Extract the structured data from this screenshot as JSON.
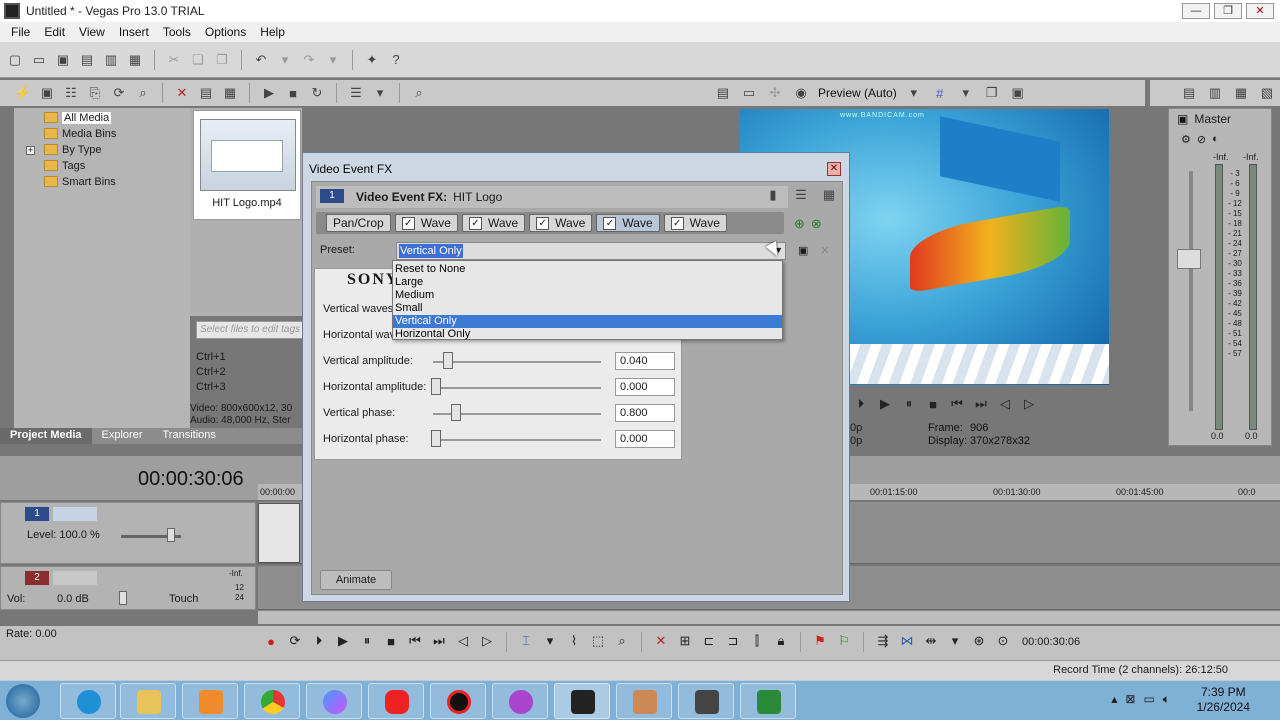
{
  "window": {
    "title": "Untitled * - Vegas Pro 13.0 TRIAL"
  },
  "menu": [
    "File",
    "Edit",
    "View",
    "Insert",
    "Tools",
    "Options",
    "Help"
  ],
  "explorer": {
    "tree": [
      {
        "label": "All Media",
        "selected": true
      },
      {
        "label": "Media Bins"
      },
      {
        "label": "By Type"
      },
      {
        "label": "Tags"
      },
      {
        "label": "Smart Bins"
      }
    ],
    "media_file": "HIT Logo.mp4",
    "tag_placeholder": "Select files to edit tags",
    "shortcuts": [
      "Ctrl+1",
      "Ctrl+2",
      "Ctrl+3"
    ],
    "media_info_line1": "Video: 800x600x12, 30",
    "media_info_line2": "Audio: 48,000 Hz, Ster",
    "tabs": [
      "Project Media",
      "Explorer",
      "Transitions"
    ]
  },
  "preview": {
    "mode_label": "Preview (Auto)",
    "watermark": "www.BANDICAM.com",
    "res_line1": "0p",
    "res_line2": "0p",
    "frame_label": "Frame:",
    "frame_value": "906",
    "display_label": "Display:",
    "display_value": "370x278x32"
  },
  "master": {
    "title": "Master",
    "inf_left": "-Inf.",
    "inf_right": "-Inf.",
    "scale": [
      "3",
      "6",
      "9",
      "12",
      "15",
      "18",
      "21",
      "24",
      "27",
      "30",
      "33",
      "36",
      "39",
      "42",
      "45",
      "48",
      "51",
      "54",
      "57"
    ],
    "foot_left": "0.0",
    "foot_right": "0.0"
  },
  "timeline": {
    "timecode": "00:00:30:06",
    "ruler": [
      "00:00:00",
      "00:01:15:00",
      "00:01:30:00",
      "00:01:45:00",
      "00:0"
    ],
    "video_track": {
      "number": "1",
      "level_label": "Level: 100.0 %"
    },
    "audio_track": {
      "number": "2",
      "vol_label": "Vol:",
      "vol_value": "0.0 dB",
      "mode_label": "Touch",
      "inf_label": "-Inf.",
      "meter_a": "12",
      "meter_b": "24"
    },
    "rate_label": "Rate: 0.00",
    "bottom_timecode": "00:00:30:06",
    "record_time": "Record Time (2 channels): 26:12:50"
  },
  "dialog": {
    "title": "Video Event FX",
    "close": "✕",
    "head_number": "1",
    "head_title_bold": "Video Event FX:",
    "head_title_rest": "HIT Logo",
    "chain": [
      "Pan/Crop",
      "Wave",
      "Wave",
      "Wave",
      "Wave",
      "Wave"
    ],
    "preset_label": "Preset:",
    "preset_value": "Vertical Only",
    "brand": "SONY",
    "params": [
      {
        "label": "Vertical waves:",
        "value": ""
      },
      {
        "label": "Horizontal waves:",
        "value": ""
      },
      {
        "label": "Vertical amplitude:",
        "value": "0.040"
      },
      {
        "label": "Horizontal amplitude:",
        "value": "0.000"
      },
      {
        "label": "Vertical phase:",
        "value": "0.800"
      },
      {
        "label": "Horizontal phase:",
        "value": "0.000"
      }
    ],
    "animate_label": "Animate",
    "dropdown_options": [
      "Reset to None",
      "Large",
      "Medium",
      "Small",
      "Vertical Only",
      "Horizontal Only"
    ],
    "dropdown_selected": "Vertical Only"
  },
  "taskbar": {
    "time": "7:39 PM",
    "date": "1/26/2024"
  }
}
